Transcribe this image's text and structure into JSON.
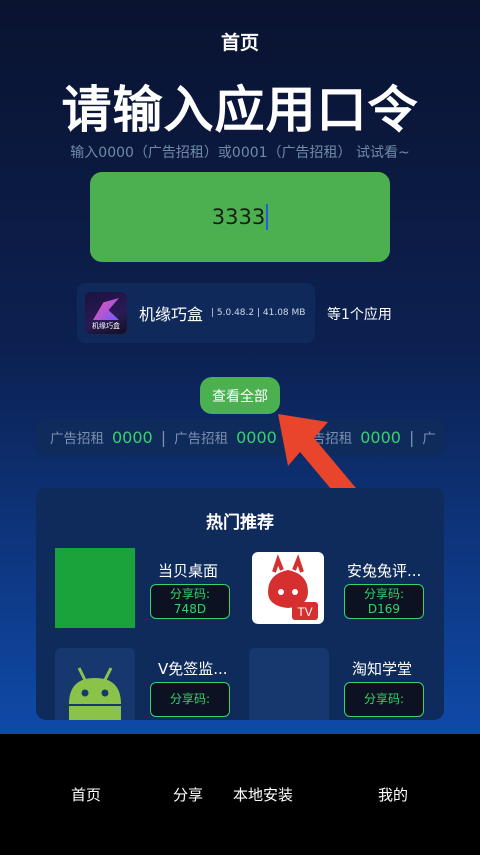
{
  "header": {
    "title": "首页"
  },
  "main": {
    "big_title": "请输入应用口令",
    "hint": "输入0000（广告招租）或0001（广告招租） 试试看~",
    "code_value": "3333",
    "app": {
      "icon_text": "机缘巧盒",
      "name": "机缘巧盒",
      "meta": "| 5.0.48.2 | 41.08 MB",
      "count_text": "等1个应用"
    },
    "view_all_label": "查看全部",
    "ticker": [
      {
        "label": "广告招租",
        "code": "0000"
      },
      {
        "label": "广告招租",
        "code": "0000"
      },
      {
        "label": "广告招租",
        "code": "0000"
      },
      {
        "label": "广",
        "code": ""
      }
    ]
  },
  "hot": {
    "title": "热门推荐",
    "items": [
      {
        "name": "当贝桌面",
        "share_label": "分享码:",
        "share_code": "748D",
        "thumb": "green-square"
      },
      {
        "name": "安兔兔评...",
        "share_label": "分享码:",
        "share_code": "D169",
        "thumb": "antutu-icon"
      },
      {
        "name": "V免签监...",
        "share_label": "分享码:",
        "share_code": "",
        "thumb": "android-icon"
      },
      {
        "name": "淘知学堂",
        "share_label": "分享码:",
        "share_code": "",
        "thumb": "placeholder"
      }
    ]
  },
  "bottom_nav": {
    "items": [
      "首页",
      "分享",
      "本地安装",
      "我的"
    ]
  },
  "colors": {
    "accent_green": "#4caf50",
    "code_green": "#35d36c",
    "arrow_red": "#e8452c"
  }
}
